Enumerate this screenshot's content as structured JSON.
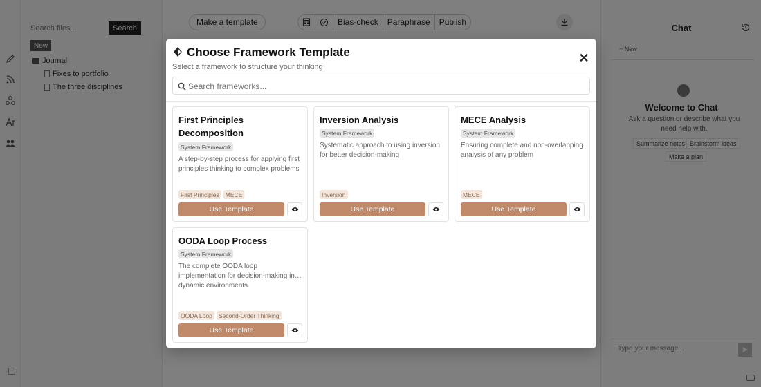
{
  "background": {
    "file_panel": {
      "search_placeholder": "Search files...",
      "search_label": "Search",
      "new_label": "New",
      "folder": "Journal",
      "files": [
        "Fixes to portfolio",
        "The three disciplines"
      ]
    },
    "toolbar": {
      "make_template": "Make a template",
      "bias_check": "Bias-check",
      "paraphrase": "Paraphrase",
      "publish": "Publish"
    },
    "chat": {
      "title": "Chat",
      "new_label": "+ New",
      "welcome": "Welcome to Chat",
      "welcome_sub": "Ask a question or describe what you need help with.",
      "suggestions": [
        "Summarize notes",
        "Brainstorm ideas",
        "Make a plan"
      ],
      "input_placeholder": "Type your message..."
    }
  },
  "modal": {
    "title": "Choose Framework Template",
    "subtitle": "Select a framework to structure your thinking",
    "search_placeholder": "Search frameworks...",
    "use_label": "Use Template",
    "cards": [
      {
        "title": "First Principles Decomposition",
        "badge": "System Framework",
        "description": "A step-by-step process for applying first principles thinking to complex problems",
        "tags": [
          "First Principles",
          "MECE"
        ]
      },
      {
        "title": "Inversion Analysis",
        "badge": "System Framework",
        "description": "Systematic approach to using inversion for better decision-making",
        "tags": [
          "Inversion"
        ]
      },
      {
        "title": "MECE Analysis",
        "badge": "System Framework",
        "description": "Ensuring complete and non-overlapping analysis of any problem",
        "tags": [
          "MECE"
        ]
      },
      {
        "title": "OODA Loop Process",
        "badge": "System Framework",
        "description": "The complete OODA loop implementation for decision-making in… dynamic environments",
        "tags": [
          "OODA Loop",
          "Second-Order Thinking"
        ]
      }
    ]
  }
}
